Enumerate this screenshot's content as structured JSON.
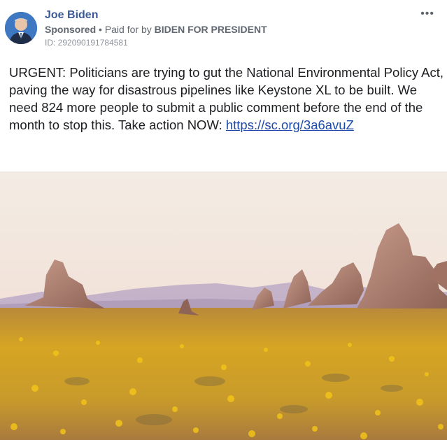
{
  "post": {
    "author_name": "Joe Biden",
    "sponsored_label": "Sponsored",
    "separator": "•",
    "paid_for_prefix": "Paid for by",
    "paid_for_by": "BIDEN FOR PRESIDENT",
    "ad_id": "ID: 292090191784581",
    "more_options": "•••",
    "body_text": "URGENT: Politicians are trying to gut the National Environmental Policy Act, paving the way for disastrous pipelines like Keystone XL to be built. We need 824 more people to submit a public comment before the end of the month to stop this. Take action NOW:",
    "link_text": "https://sc.org/3a6avuZ"
  },
  "icons": {
    "avatar": "profile-photo",
    "more": "more-options-icon"
  },
  "colors": {
    "author_name": "#3b5998",
    "link": "#1d4aa8",
    "meta_text": "#606770",
    "body_text": "#1c1e21"
  }
}
